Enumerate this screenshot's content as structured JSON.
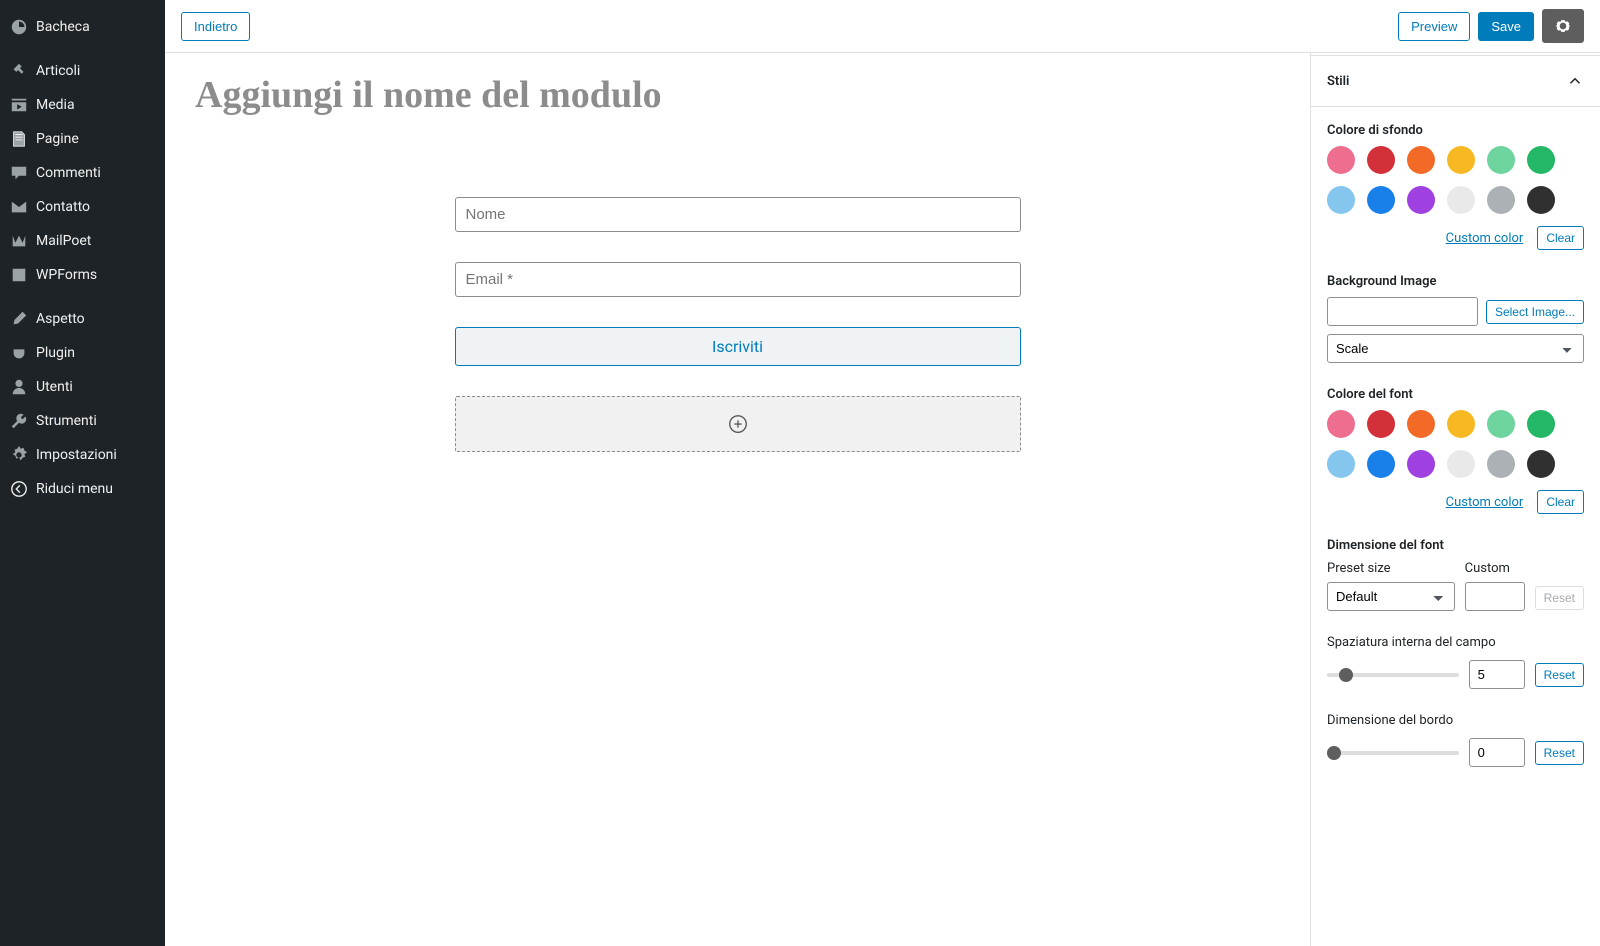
{
  "sidebar": {
    "items": [
      {
        "label": "Bacheca",
        "icon": "dashboard"
      },
      {
        "label": "Articoli",
        "icon": "pin"
      },
      {
        "label": "Media",
        "icon": "media"
      },
      {
        "label": "Pagine",
        "icon": "page"
      },
      {
        "label": "Commenti",
        "icon": "comment"
      },
      {
        "label": "Contatto",
        "icon": "mail"
      },
      {
        "label": "MailPoet",
        "icon": "mailpoet"
      },
      {
        "label": "WPForms",
        "icon": "wpforms"
      },
      {
        "label": "Aspetto",
        "icon": "brush"
      },
      {
        "label": "Plugin",
        "icon": "plug"
      },
      {
        "label": "Utenti",
        "icon": "user"
      },
      {
        "label": "Strumenti",
        "icon": "wrench"
      },
      {
        "label": "Impostazioni",
        "icon": "cog"
      },
      {
        "label": "Riduci menu",
        "icon": "collapse"
      }
    ]
  },
  "topbar": {
    "back": "Indietro",
    "preview": "Preview",
    "save": "Save"
  },
  "canvas": {
    "title_placeholder": "Aggiungi il nome del modulo",
    "name_placeholder": "Nome",
    "email_placeholder": "Email *",
    "submit_label": "Iscriviti"
  },
  "panel": {
    "title": "Stili",
    "bg_color_label": "Colore di sfondo",
    "custom_color": "Custom color",
    "clear": "Clear",
    "bg_image_label": "Background Image",
    "select_image": "Select Image...",
    "scale_label": "Scale",
    "font_color_label": "Colore del font",
    "font_size_label": "Dimensione del font",
    "preset_size_label": "Preset size",
    "preset_size_value": "Default",
    "custom_label": "Custom",
    "reset": "Reset",
    "padding_label": "Spaziatura interna del campo",
    "padding_value": "5",
    "border_label": "Dimensione del bordo",
    "border_value": "0",
    "swatches": [
      "#ee6e8f",
      "#d33139",
      "#f26a25",
      "#f7b824",
      "#6ed49e",
      "#24b768",
      "#85c6ee",
      "#1880e8",
      "#9f41e0",
      "#e9e9e9",
      "#acb1b5",
      "#303030"
    ]
  }
}
